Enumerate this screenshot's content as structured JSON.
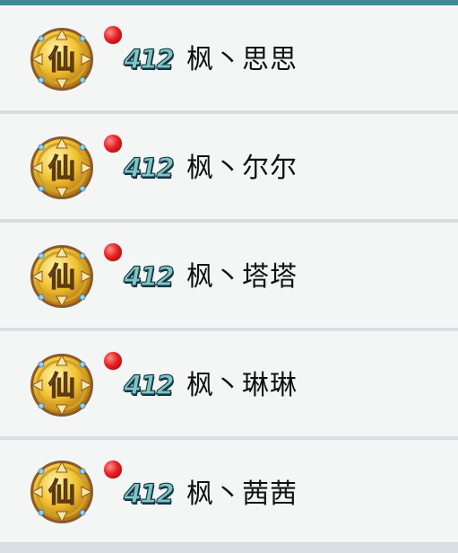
{
  "colors": {
    "top_bar": "#3f8a99",
    "row_bg": "#f3f6f5",
    "divider": "#d8dee3",
    "level_fill": "#7fc6c0",
    "online_dot": "#e62222"
  },
  "friends": [
    {
      "badge_icon": "xian-gold-badge-icon",
      "badge_char": "仙",
      "level": "412",
      "name": "枫丶思思",
      "online": true
    },
    {
      "badge_icon": "xian-gold-badge-icon",
      "badge_char": "仙",
      "level": "412",
      "name": "枫丶尔尔",
      "online": true
    },
    {
      "badge_icon": "xian-gold-badge-icon",
      "badge_char": "仙",
      "level": "412",
      "name": "枫丶塔塔",
      "online": true
    },
    {
      "badge_icon": "xian-gold-badge-icon",
      "badge_char": "仙",
      "level": "412",
      "name": "枫丶琳琳",
      "online": true
    },
    {
      "badge_icon": "xian-gold-badge-icon",
      "badge_char": "仙",
      "level": "412",
      "name": "枫丶茜茜",
      "online": true
    }
  ]
}
